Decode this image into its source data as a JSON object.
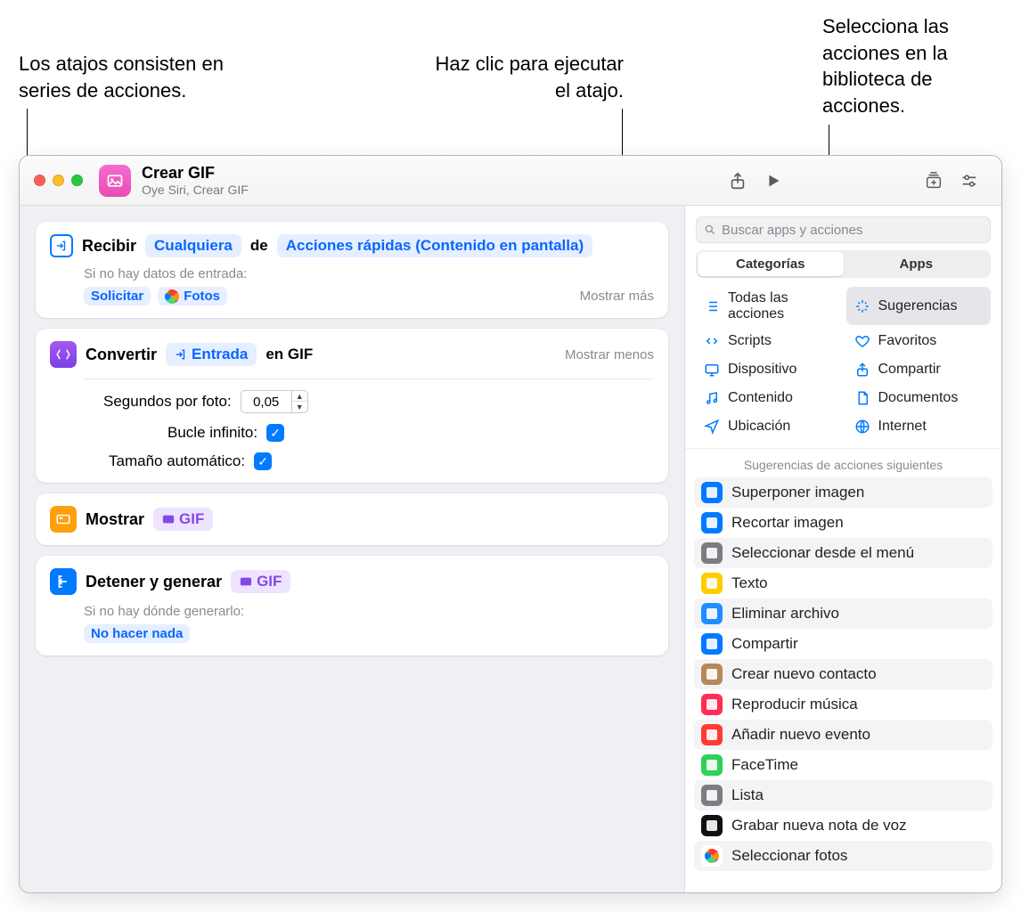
{
  "callouts": {
    "left": "Los atajos consisten en series de acciones.",
    "center": "Haz clic para ejecutar el atajo.",
    "right": "Selecciona las acciones en la biblioteca de acciones."
  },
  "header": {
    "title": "Crear GIF",
    "subtitle": "Oye Siri, Crear GIF"
  },
  "actions": {
    "receive": {
      "verb": "Recibir",
      "any": "Cualquiera",
      "from": "de",
      "source": "Acciones rápidas (Contenido en pantalla)",
      "no_input": "Si no hay datos de entrada:",
      "ask": "Solicitar",
      "photos": "Fotos",
      "show_more": "Mostrar más"
    },
    "convert": {
      "verb": "Convertir",
      "input_pill": "Entrada",
      "to": "en GIF",
      "show_less": "Mostrar menos",
      "sec_label": "Segundos por foto:",
      "sec_value": "0,05",
      "loop_label": "Bucle infinito:",
      "autosize_label": "Tamaño automático:"
    },
    "show": {
      "verb": "Mostrar",
      "gif": "GIF"
    },
    "stop": {
      "verb": "Detener y generar",
      "gif": "GIF",
      "nowhere": "Si no hay dónde generarlo:",
      "nothing": "No hacer nada"
    }
  },
  "sidebar": {
    "search_placeholder": "Buscar apps y acciones",
    "seg": {
      "categories": "Categorías",
      "apps": "Apps"
    },
    "categories": [
      {
        "label": "Todas las acciones",
        "icon": "list"
      },
      {
        "label": "Sugerencias",
        "icon": "sparkle",
        "active": true
      },
      {
        "label": "Scripts",
        "icon": "scripts"
      },
      {
        "label": "Favoritos",
        "icon": "heart"
      },
      {
        "label": "Dispositivo",
        "icon": "display"
      },
      {
        "label": "Compartir",
        "icon": "share"
      },
      {
        "label": "Contenido",
        "icon": "media"
      },
      {
        "label": "Documentos",
        "icon": "doc"
      },
      {
        "label": "Ubicación",
        "icon": "location"
      },
      {
        "label": "Internet",
        "icon": "globe"
      }
    ],
    "suggestions_header": "Sugerencias de acciones siguientes",
    "suggestions": [
      {
        "label": "Superponer imagen",
        "color": "#007aff"
      },
      {
        "label": "Recortar imagen",
        "color": "#007aff"
      },
      {
        "label": "Seleccionar desde el menú",
        "color": "#7c7c82"
      },
      {
        "label": "Texto",
        "color": "#ffcc00"
      },
      {
        "label": "Eliminar archivo",
        "color": "#1f8fff"
      },
      {
        "label": "Compartir",
        "color": "#007aff"
      },
      {
        "label": "Crear nuevo contacto",
        "color": "#b58a5a"
      },
      {
        "label": "Reproducir música",
        "color": "#ff2d55"
      },
      {
        "label": "Añadir nuevo evento",
        "color": "#ff3b30"
      },
      {
        "label": "FaceTime",
        "color": "#30d158"
      },
      {
        "label": "Lista",
        "color": "#7c7c82"
      },
      {
        "label": "Grabar nueva nota de voz",
        "color": "#111"
      },
      {
        "label": "Seleccionar fotos",
        "color": "#fff"
      }
    ]
  }
}
